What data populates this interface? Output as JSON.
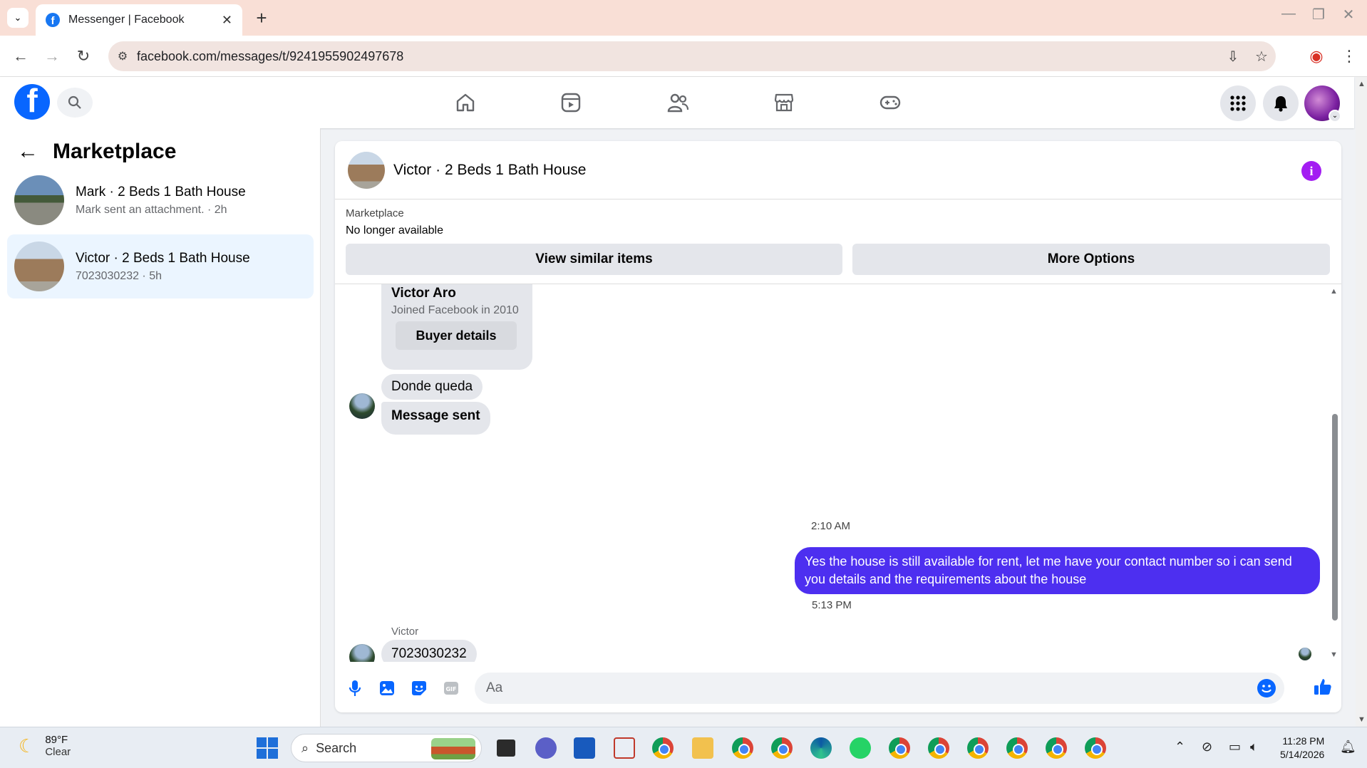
{
  "browser": {
    "tab_title": "Messenger | Facebook",
    "url": "facebook.com/messages/t/9241955902497678"
  },
  "sidebar": {
    "title": "Marketplace",
    "conversations": [
      {
        "name": "Mark · 2 Beds 1 Bath House",
        "preview": "Mark sent an attachment. · 2h",
        "active": false
      },
      {
        "name": "Victor · 2 Beds 1 Bath House",
        "preview": "7023030232 · 5h",
        "active": true
      }
    ]
  },
  "chat": {
    "title": "Victor · 2 Beds 1 Bath House",
    "marketplace_label": "Marketplace",
    "listing_status": "No longer available",
    "view_similar_label": "View similar items",
    "more_options_label": "More Options",
    "buyer_card": {
      "name": "Victor Aro",
      "joined": "Joined Facebook in 2010",
      "button": "Buyer details"
    },
    "messages": {
      "m1": "Donde queda",
      "m2": "Message sent",
      "ts1": "2:10 AM",
      "m3": "Yes the house is still available for rent, let me have your contact number so i can send you details and the requirements about the house",
      "ts2": "5:13 PM",
      "sender": "Victor",
      "m4": "7023030232"
    },
    "composer_placeholder": "Aa"
  },
  "taskbar": {
    "weather_temp": "89°F",
    "weather_desc": "Clear",
    "search_label": "Search",
    "time": "11:28 PM",
    "date": "5/14/2026"
  },
  "colors": {
    "fb_blue": "#0866ff",
    "outgoing_bubble": "#4d2ff0",
    "info_purple": "#a31df2",
    "active_conversation": "#ebf5ff"
  }
}
